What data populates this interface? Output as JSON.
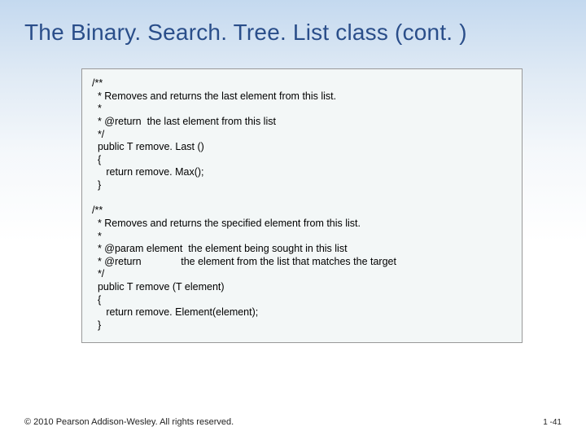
{
  "title": "The Binary. Search. Tree. List class (cont. )",
  "code": "/**\n  * Removes and returns the last element from this list.\n  *\n  * @return  the last element from this list\n  */\n  public T remove. Last ()\n  {\n     return remove. Max();\n  }\n\n/**\n  * Removes and returns the specified element from this list.\n  *\n  * @param element  the element being sought in this list\n  * @return              the element from the list that matches the target\n  */\n  public T remove (T element)\n  {\n     return remove. Element(element);\n  }",
  "footer": "© 2010 Pearson Addison-Wesley. All rights reserved.",
  "page": "1 -41"
}
